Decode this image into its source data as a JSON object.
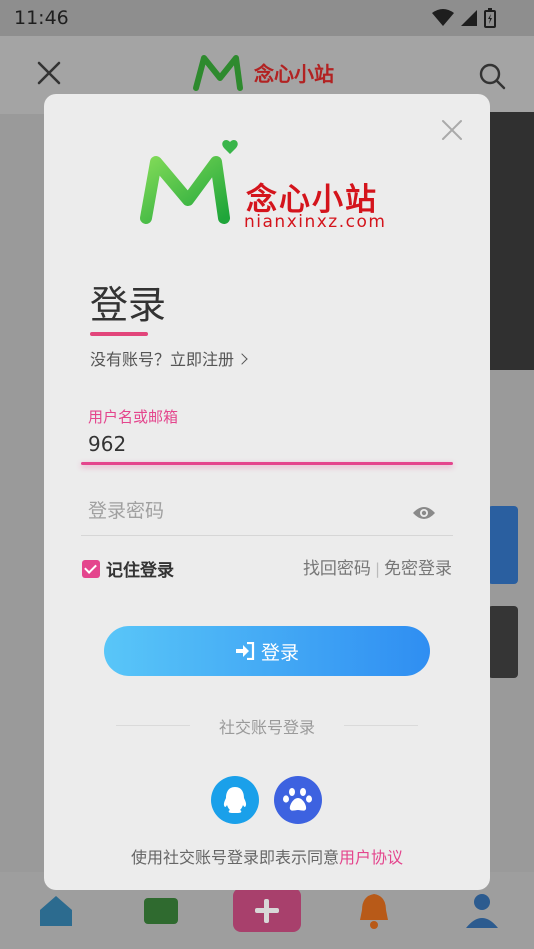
{
  "status_bar": {
    "time": "11:46"
  },
  "background": {
    "header_logo_text": "念心小站"
  },
  "modal": {
    "logo_cn": "念心小站",
    "logo_en": "nianxinxz.com",
    "title": "登录",
    "register_prompt": "没有账号？立即注册",
    "username_label": "用户名或邮箱",
    "username_value": "962",
    "password_placeholder": "登录密码",
    "remember_label": "记住登录",
    "forgot_label": "找回密码",
    "separator": "|",
    "passwordless_label": "免密登录",
    "login_button": "登录",
    "social_title": "社交账号登录",
    "terms_prefix": "使用社交账号登录即表示同意",
    "terms_link": "用户协议"
  },
  "colors": {
    "accent_pink": "#e4458d",
    "button_start": "#59c6f8",
    "button_end": "#2f8ef2",
    "logo_red": "#d4141c",
    "logo_green": "#3cb43c"
  }
}
